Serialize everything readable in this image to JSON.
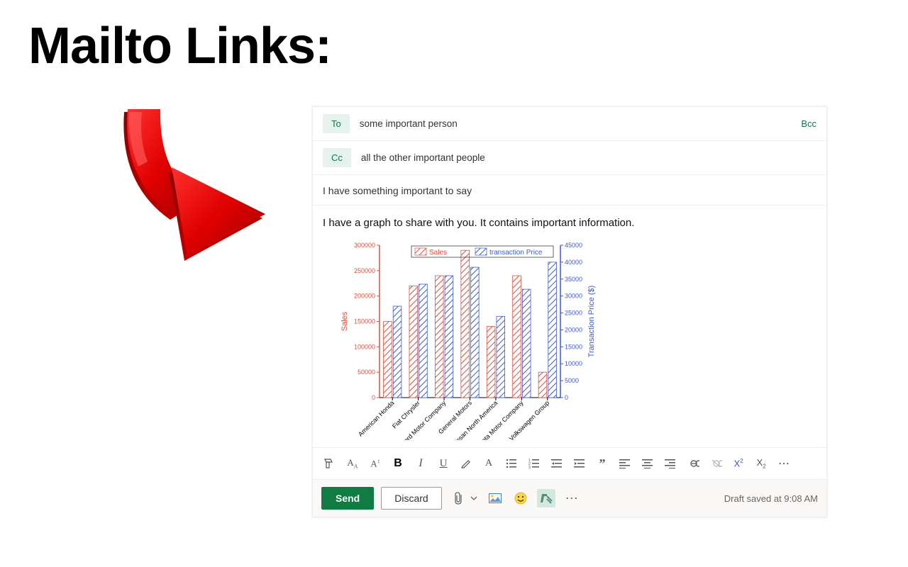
{
  "page": {
    "title": "Mailto Links:"
  },
  "compose": {
    "to_label": "To",
    "to_value": "some important person",
    "cc_label": "Cc",
    "cc_value": "all the other important people",
    "bcc_label": "Bcc",
    "subject": "I have something important to say",
    "body_text": "I have a graph to share with you. It contains important information."
  },
  "actions": {
    "send": "Send",
    "discard": "Discard",
    "draft_status": "Draft saved at 9:08 AM"
  },
  "format_icons": [
    {
      "name": "format-painter-icon",
      "glyph": "✓"
    },
    {
      "name": "font-size-down-icon",
      "glyph": "A"
    },
    {
      "name": "font-size-up-icon",
      "glyph": "A"
    },
    {
      "name": "bold-icon",
      "glyph": "B"
    },
    {
      "name": "italic-icon",
      "glyph": "I"
    },
    {
      "name": "underline-icon",
      "glyph": "U"
    },
    {
      "name": "highlight-icon",
      "glyph": "✎"
    },
    {
      "name": "font-color-icon",
      "glyph": "A"
    },
    {
      "name": "bullets-icon",
      "glyph": "≡"
    },
    {
      "name": "numbering-icon",
      "glyph": "≡"
    },
    {
      "name": "outdent-icon",
      "glyph": "⇤"
    },
    {
      "name": "indent-icon",
      "glyph": "⇥"
    },
    {
      "name": "quote-icon",
      "glyph": "”"
    },
    {
      "name": "align-left-icon",
      "glyph": "≡"
    },
    {
      "name": "align-center-icon",
      "glyph": "≡"
    },
    {
      "name": "align-right-icon",
      "glyph": "≡"
    },
    {
      "name": "link-icon",
      "glyph": "🔗"
    },
    {
      "name": "unlink-icon",
      "glyph": "⊘"
    },
    {
      "name": "superscript-icon",
      "glyph": "X²"
    },
    {
      "name": "subscript-icon",
      "glyph": "X₂"
    },
    {
      "name": "more-format-icon",
      "glyph": "⋯"
    }
  ],
  "chart_data": {
    "type": "bar",
    "title": "",
    "xlabel": "",
    "ylabel_left": "Sales",
    "ylabel_right": "Transaction Price ($)",
    "categories": [
      "American Honda",
      "Fiat Chrysler",
      "Ford Motor Company",
      "General Motors",
      "Nissan North America",
      "Toyota Motor Company",
      "Volkswagen Group"
    ],
    "series": [
      {
        "name": "Sales",
        "axis": "left",
        "color": "#e74c3c",
        "values": [
          150000,
          220000,
          240000,
          290000,
          140000,
          240000,
          50000
        ]
      },
      {
        "name": "transaction Price",
        "axis": "right",
        "color": "#3b5bdb",
        "values": [
          27000,
          33500,
          36000,
          38500,
          24000,
          32000,
          40000
        ]
      }
    ],
    "ylim_left": [
      0,
      300000
    ],
    "ylim_right": [
      0,
      45000
    ],
    "yticks_left": [
      0,
      50000,
      100000,
      150000,
      200000,
      250000,
      300000
    ],
    "yticks_right": [
      0,
      5000,
      10000,
      15000,
      20000,
      25000,
      30000,
      35000,
      40000,
      45000
    ]
  }
}
